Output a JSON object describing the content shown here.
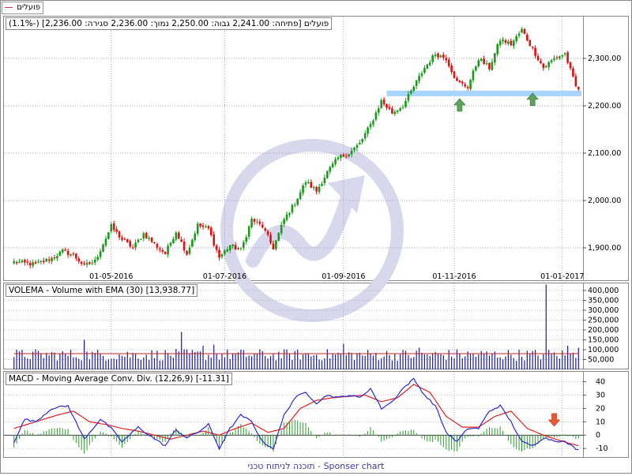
{
  "legend": {
    "label": "פועלים",
    "color": "#cc3355"
  },
  "price_panel": {
    "title": "פועלים [פתיחה: 2,241.00 גבוה: 2,250.00 נמוך: 2,236.00 סגירה: 2,236.00] (-1.1%)"
  },
  "volume_panel": {
    "title": "VOLEMA - Volume with EMA (30) [13,938.77]"
  },
  "macd_panel": {
    "title": "MACD - Moving Average Conv. Div. (12,26,9) [-11.31]"
  },
  "footer": {
    "text": "תוכנה לניתוח טכני - Sponser chart"
  },
  "colors": {
    "up": "#1a9a1a",
    "down": "#dd1111",
    "support": "#a8d4ff",
    "arrow_up": "#5aa55a",
    "arrow_down": "#ee5533",
    "macd": "#2a2ad0",
    "signal": "#e02020",
    "volume": "#1a1a99",
    "volume_ema": "#cc2222",
    "hist_up": "#2b9b2b",
    "hist_down": "#2b9b2b",
    "grid": "#8888b0",
    "watermark": "#d8d8ec"
  },
  "chart_data": [
    {
      "type": "candlestick",
      "name": "price",
      "ylim": [
        1830,
        2390
      ],
      "y_ticks": [
        1900,
        2000,
        2100,
        2200,
        2300
      ],
      "y_tick_labels": [
        "1,900.00",
        "2,000.00",
        "2,100.00",
        "2,200.00",
        "2,300.00"
      ],
      "x_tick_labels": [
        "01-05-2016",
        "01-07-2016",
        "01-09-2016",
        "01-11-2016",
        "01-01-2017"
      ],
      "n_bars": 210,
      "anchor_closes": [
        [
          0,
          1870
        ],
        [
          8,
          1865
        ],
        [
          14,
          1878
        ],
        [
          18,
          1893
        ],
        [
          22,
          1885
        ],
        [
          26,
          1862
        ],
        [
          30,
          1872
        ],
        [
          36,
          1945
        ],
        [
          40,
          1918
        ],
        [
          44,
          1900
        ],
        [
          48,
          1930
        ],
        [
          52,
          1908
        ],
        [
          56,
          1888
        ],
        [
          60,
          1935
        ],
        [
          64,
          1888
        ],
        [
          68,
          1948
        ],
        [
          72,
          1940
        ],
        [
          76,
          1880
        ],
        [
          80,
          1905
        ],
        [
          84,
          1895
        ],
        [
          88,
          1960
        ],
        [
          92,
          1945
        ],
        [
          96,
          1900
        ],
        [
          100,
          1960
        ],
        [
          104,
          1995
        ],
        [
          108,
          2040
        ],
        [
          112,
          2020
        ],
        [
          116,
          2060
        ],
        [
          120,
          2090
        ],
        [
          124,
          2100
        ],
        [
          128,
          2120
        ],
        [
          132,
          2160
        ],
        [
          136,
          2210
        ],
        [
          140,
          2185
        ],
        [
          144,
          2200
        ],
        [
          148,
          2240
        ],
        [
          152,
          2280
        ],
        [
          156,
          2310
        ],
        [
          160,
          2300
        ],
        [
          164,
          2250
        ],
        [
          168,
          2240
        ],
        [
          172,
          2300
        ],
        [
          176,
          2280
        ],
        [
          180,
          2340
        ],
        [
          184,
          2330
        ],
        [
          188,
          2360
        ],
        [
          192,
          2320
        ],
        [
          196,
          2280
        ],
        [
          200,
          2300
        ],
        [
          204,
          2310
        ],
        [
          208,
          2240
        ],
        [
          209,
          2236
        ]
      ],
      "support_level": 2226,
      "annotations": [
        {
          "type": "arrow-up",
          "bar": 165,
          "y": 2200
        },
        {
          "type": "arrow-up",
          "bar": 192,
          "y": 2212
        }
      ]
    },
    {
      "type": "bar",
      "name": "volume",
      "ylim": [
        0,
        440000
      ],
      "y_ticks": [
        50000,
        100000,
        150000,
        200000,
        250000,
        300000,
        350000,
        400000
      ],
      "y_tick_labels": [
        "50,000",
        "100,000",
        "150,000",
        "200,000",
        "250,000",
        "300,000",
        "350,000",
        "400,000"
      ],
      "base_volume": 80000,
      "spikes": [
        [
          26,
          150000
        ],
        [
          62,
          190000
        ],
        [
          70,
          120000
        ],
        [
          74,
          125000
        ],
        [
          122,
          130000
        ],
        [
          150,
          110000
        ],
        [
          197,
          430000
        ],
        [
          205,
          120000
        ],
        [
          209,
          110000
        ]
      ],
      "ema_value": 80000
    },
    {
      "type": "line",
      "name": "macd",
      "ylim": [
        -17,
        48
      ],
      "y_ticks": [
        -10,
        0,
        10,
        20,
        30,
        40
      ],
      "y_tick_labels": [
        "-10",
        "0",
        "10",
        "20",
        "30",
        "40"
      ],
      "macd_anchors": [
        [
          0,
          -5
        ],
        [
          4,
          12
        ],
        [
          8,
          10
        ],
        [
          14,
          20
        ],
        [
          20,
          22
        ],
        [
          26,
          -3
        ],
        [
          32,
          12
        ],
        [
          36,
          5
        ],
        [
          40,
          -5
        ],
        [
          46,
          6
        ],
        [
          50,
          0
        ],
        [
          56,
          -8
        ],
        [
          60,
          4
        ],
        [
          64,
          -2
        ],
        [
          68,
          2
        ],
        [
          72,
          8
        ],
        [
          76,
          -10
        ],
        [
          80,
          5
        ],
        [
          84,
          15
        ],
        [
          88,
          10
        ],
        [
          92,
          -5
        ],
        [
          96,
          -10
        ],
        [
          100,
          15
        ],
        [
          104,
          28
        ],
        [
          108,
          32
        ],
        [
          112,
          24
        ],
        [
          116,
          30
        ],
        [
          120,
          28
        ],
        [
          124,
          30
        ],
        [
          128,
          28
        ],
        [
          132,
          35
        ],
        [
          136,
          20
        ],
        [
          140,
          25
        ],
        [
          144,
          35
        ],
        [
          148,
          42
        ],
        [
          152,
          30
        ],
        [
          156,
          22
        ],
        [
          160,
          2
        ],
        [
          164,
          -5
        ],
        [
          168,
          5
        ],
        [
          172,
          5
        ],
        [
          176,
          18
        ],
        [
          180,
          22
        ],
        [
          184,
          10
        ],
        [
          188,
          -5
        ],
        [
          192,
          -8
        ],
        [
          196,
          -2
        ],
        [
          200,
          -4
        ],
        [
          204,
          -5
        ],
        [
          209,
          -11.31
        ]
      ],
      "signal_anchors": [
        [
          0,
          5
        ],
        [
          8,
          10
        ],
        [
          16,
          15
        ],
        [
          22,
          18
        ],
        [
          28,
          10
        ],
        [
          34,
          8
        ],
        [
          40,
          5
        ],
        [
          46,
          3
        ],
        [
          52,
          0
        ],
        [
          58,
          -3
        ],
        [
          64,
          0
        ],
        [
          70,
          3
        ],
        [
          76,
          0
        ],
        [
          82,
          5
        ],
        [
          88,
          9
        ],
        [
          94,
          2
        ],
        [
          100,
          5
        ],
        [
          106,
          20
        ],
        [
          112,
          26
        ],
        [
          118,
          28
        ],
        [
          124,
          29
        ],
        [
          130,
          30
        ],
        [
          136,
          25
        ],
        [
          142,
          28
        ],
        [
          148,
          38
        ],
        [
          154,
          32
        ],
        [
          160,
          14
        ],
        [
          166,
          6
        ],
        [
          172,
          6
        ],
        [
          178,
          14
        ],
        [
          184,
          18
        ],
        [
          190,
          5
        ],
        [
          196,
          0
        ],
        [
          202,
          -4
        ],
        [
          209,
          -8
        ]
      ],
      "annotations": [
        {
          "type": "arrow-down",
          "bar": 200,
          "y": 12
        }
      ]
    }
  ]
}
